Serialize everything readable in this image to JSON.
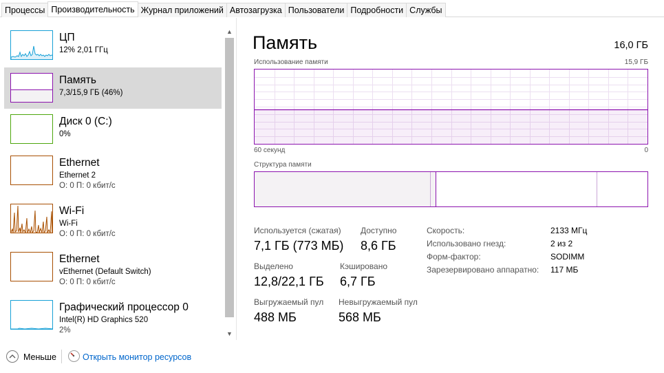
{
  "tabs": [
    {
      "label": "Процессы"
    },
    {
      "label": "Производительность"
    },
    {
      "label": "Журнал приложений"
    },
    {
      "label": "Автозагрузка"
    },
    {
      "label": "Пользователи"
    },
    {
      "label": "Подробности"
    },
    {
      "label": "Службы"
    }
  ],
  "active_tab_index": 1,
  "sidebar": {
    "items": [
      {
        "title": "ЦП",
        "sub": "12% 2,01 ГГц",
        "sub2": "",
        "color": "#17a0d6",
        "selected": false
      },
      {
        "title": "Память",
        "sub": "7,3/15,9 ГБ (46%)",
        "sub2": "",
        "color": "#8b12ae",
        "selected": true
      },
      {
        "title": "Диск 0 (C:)",
        "sub": "0%",
        "sub2": "",
        "color": "#4da60c",
        "selected": false
      },
      {
        "title": "Ethernet",
        "sub": "Ethernet 2",
        "sub2": "О: 0 П: 0 кбит/с",
        "color": "#a74f01",
        "selected": false
      },
      {
        "title": "Wi-Fi",
        "sub": "Wi-Fi",
        "sub2": "О: 0 П: 0 кбит/с",
        "color": "#a74f01",
        "selected": false
      },
      {
        "title": "Ethernet",
        "sub": "vEthernet (Default Switch)",
        "sub2": "О: 0 П: 0 кбит/с",
        "color": "#a74f01",
        "selected": false
      },
      {
        "title": "Графический процессор 0",
        "sub": "Intel(R) HD Graphics 520",
        "sub2": "2%",
        "color": "#17a0d6",
        "selected": false
      }
    ]
  },
  "memory": {
    "title": "Память",
    "total": "16,0 ГБ",
    "usage_label": "Использование памяти",
    "usage_max": "15,9 ГБ",
    "time_left": "60 секунд",
    "time_right": "0",
    "usage_fraction": 0.46,
    "structure_label": "Структура памяти",
    "stats": {
      "in_use_label": "Используется (сжатая)",
      "in_use_value": "7,1 ГБ (773 МБ)",
      "available_label": "Доступно",
      "available_value": "8,6 ГБ",
      "committed_label": "Выделено",
      "committed_value": "12,8/22,1 ГБ",
      "cached_label": "Кэшировано",
      "cached_value": "6,7 ГБ",
      "paged_label": "Выгружаемый пул",
      "paged_value": "488 МБ",
      "nonpaged_label": "Невыгружаемый пул",
      "nonpaged_value": "568 МБ"
    },
    "specs": {
      "speed_label": "Скорость:",
      "speed_value": "2133 МГц",
      "slots_label": "Использовано гнезд:",
      "slots_value": "2 из 2",
      "form_label": "Форм-фактор:",
      "form_value": "SODIMM",
      "reserved_label": "Зарезервировано аппаратно:",
      "reserved_value": "117 МБ"
    }
  },
  "footer": {
    "fewer_label": "Меньше",
    "monitor_label": "Открыть монитор ресурсов"
  },
  "icons": {
    "fewer": "chevron-up-circle-icon",
    "monitor": "resource-monitor-icon"
  }
}
